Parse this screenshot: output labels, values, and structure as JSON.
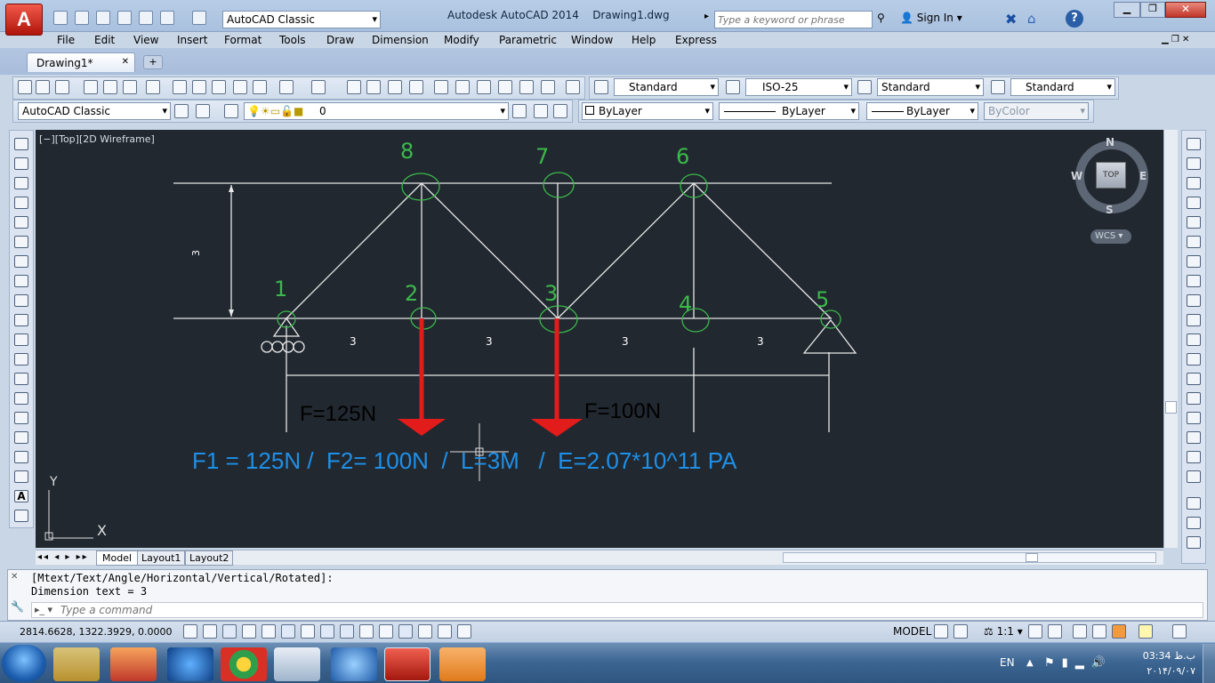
{
  "titlebar": {
    "title": "Autodesk AutoCAD 2014",
    "file": "Drawing1.dwg",
    "workspace": "AutoCAD Classic",
    "search_placeholder": "Type a keyword or phrase",
    "sign_in": "Sign In"
  },
  "menu": [
    "File",
    "Edit",
    "View",
    "Insert",
    "Format",
    "Tools",
    "Draw",
    "Dimension",
    "Modify",
    "Parametric",
    "Window",
    "Help",
    "Express"
  ],
  "doc_tab": "Drawing1*",
  "styles": {
    "text_style": "Standard",
    "dim_style": "ISO-25",
    "table_style": "Standard",
    "mleader_style": "Standard"
  },
  "layers": {
    "workspace": "AutoCAD Classic",
    "layer": "0",
    "color": "ByLayer",
    "linetype": "ByLayer",
    "lineweight": "ByLayer",
    "plotstyle": "ByColor"
  },
  "viewport": {
    "label": "[−][Top][2D Wireframe]"
  },
  "viewcube": {
    "n": "N",
    "s": "S",
    "e": "E",
    "w": "W",
    "top": "TOP",
    "wcs": "WCS"
  },
  "drawing": {
    "height_dim": "3",
    "node_labels": [
      "1",
      "2",
      "3",
      "4",
      "5",
      "6",
      "7",
      "8"
    ],
    "span_dims": [
      "3",
      "3",
      "3",
      "3"
    ],
    "force_left": "F=125N",
    "force_right": "F=100N",
    "note": "F1 = 125N /  F2= 100N  /  L=3M   /  E=2.07*10^11 PA",
    "ucs_x": "X",
    "ucs_y": "Y"
  },
  "layout_tabs": [
    "Model",
    "Layout1",
    "Layout2"
  ],
  "command": {
    "line1": "[Mtext/Text/Angle/Horizontal/Vertical/Rotated]:",
    "line2": "Dimension text = 3",
    "placeholder": "Type a command"
  },
  "status": {
    "coords": "2814.6628, 1322.3929, 0.0000",
    "model": "MODEL",
    "scale": "1:1"
  },
  "taskbar": {
    "lang": "EN",
    "time": "03:34 ب.ظ",
    "date": "۲۰۱۴/۰۹/۰۷"
  },
  "colors": {
    "label_green": "#3cb94a",
    "force_red": "#e21b1b",
    "note_blue": "#1e90e8",
    "canvas": "#212830"
  }
}
